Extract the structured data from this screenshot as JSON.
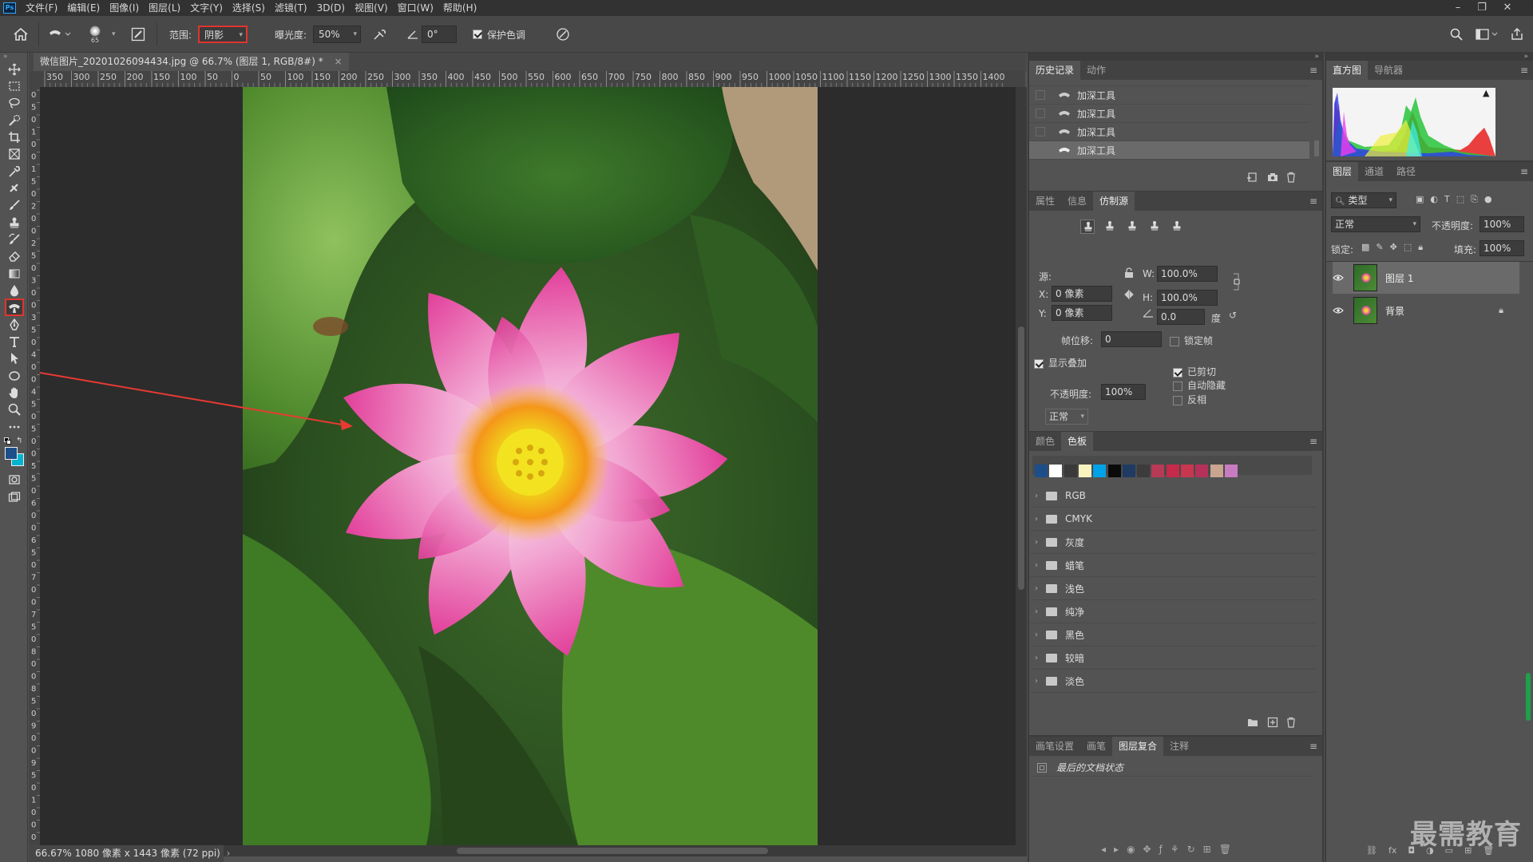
{
  "menubar": {
    "app_icon": "Ps",
    "items": [
      "文件(F)",
      "编辑(E)",
      "图像(I)",
      "图层(L)",
      "文字(Y)",
      "选择(S)",
      "滤镜(T)",
      "3D(D)",
      "视图(V)",
      "窗口(W)",
      "帮助(H)"
    ],
    "window_controls": [
      "minimize-icon",
      "restore-icon",
      "close-icon"
    ]
  },
  "options": {
    "brush_size": "65",
    "range_label": "范围:",
    "range_value": "阴影",
    "exposure_label": "曝光度:",
    "exposure_value": "50%",
    "angle_value": "0°",
    "protect_tones_label": "保护色调",
    "protect_tones_checked": true
  },
  "document": {
    "tab_title": "微信图片_20201026094434.jpg @ 66.7% (图层 1, RGB/8#) *",
    "ruler_top": [
      "350",
      "300",
      "250",
      "200",
      "150",
      "100",
      "50",
      "0",
      "50",
      "100",
      "150",
      "200",
      "250",
      "300",
      "350",
      "400",
      "450",
      "500",
      "550",
      "600",
      "650",
      "700",
      "750",
      "800",
      "850",
      "900",
      "950",
      "1000",
      "1050",
      "1100",
      "1150",
      "1200",
      "1250",
      "1300",
      "1350",
      "1400"
    ],
    "ruler_left": [
      "0",
      "5",
      "0",
      "1",
      "0",
      "0",
      "1",
      "5",
      "0",
      "2",
      "0",
      "0",
      "2",
      "5",
      "0",
      "3",
      "0",
      "0",
      "3",
      "5",
      "0",
      "4",
      "0",
      "0",
      "4",
      "5",
      "0",
      "5",
      "0",
      "0",
      "5",
      "5",
      "0",
      "6",
      "0",
      "0",
      "6",
      "5",
      "0",
      "7",
      "0",
      "0",
      "7",
      "5",
      "0",
      "8",
      "0",
      "0",
      "8",
      "5",
      "0",
      "9",
      "0",
      "0",
      "9",
      "5",
      "0",
      "1",
      "0",
      "0",
      "0"
    ],
    "status": "66.67%  1080 像素 x 1443 像素 (72 ppi)"
  },
  "history_panel": {
    "tabs": [
      "历史记录",
      "动作"
    ],
    "active_tab": "历史记录",
    "items": [
      "加深工具",
      "加深工具",
      "加深工具",
      "加深工具"
    ]
  },
  "clone_panel": {
    "tabs": [
      "属性",
      "信息",
      "仿制源"
    ],
    "active_tab": "仿制源",
    "source_label": "源:",
    "x_label": "X:",
    "x_value": "0 像素",
    "y_label": "Y:",
    "y_value": "0 像素",
    "w_label": "W:",
    "w_value": "100.0%",
    "h_label": "H:",
    "h_value": "100.0%",
    "angle_value": "0.0",
    "angle_unit": "度",
    "frame_offset_label": "帧位移:",
    "frame_offset_value": "0",
    "lock_frame_label": "锁定帧",
    "show_overlay_label": "显示叠加",
    "opacity_label": "不透明度:",
    "opacity_value": "100%",
    "blend_value": "正常",
    "clipped_label": "已剪切",
    "auto_hide_label": "自动隐藏",
    "invert_label": "反相"
  },
  "swatches_panel": {
    "tabs": [
      "颜色",
      "色板"
    ],
    "active_tab": "色板",
    "colors": [
      "#1c4f8a",
      "#ffffff",
      "#3a3a3a",
      "#f9f3c0",
      "#00a2e8",
      "#0a0a0a",
      "#1f3b63",
      "#3c3c3c",
      "#b83a56",
      "#c52a4a",
      "#c8374f",
      "#b5315a",
      "#c9a590",
      "#c77cc1"
    ],
    "folders": [
      "RGB",
      "CMYK",
      "灰度",
      "蜡笔",
      "浅色",
      "纯净",
      "黑色",
      "较暗",
      "淡色"
    ]
  },
  "comps_panel": {
    "tabs": [
      "画笔设置",
      "画笔",
      "图层复合",
      "注释"
    ],
    "active_tab": "图层复合",
    "item": "最后的文档状态"
  },
  "histogram_panel": {
    "tabs": [
      "直方图",
      "导航器"
    ],
    "active_tab": "直方图"
  },
  "layers_panel": {
    "tabs": [
      "图层",
      "通道",
      "路径"
    ],
    "active_tab": "图层",
    "filter_label": "类型",
    "blend_mode": "正常",
    "opacity_label": "不透明度:",
    "opacity_value": "100%",
    "lock_label": "锁定:",
    "fill_label": "填充:",
    "fill_value": "100%",
    "layers": [
      "图层 1",
      "背景"
    ]
  },
  "watermark": "最需教育"
}
